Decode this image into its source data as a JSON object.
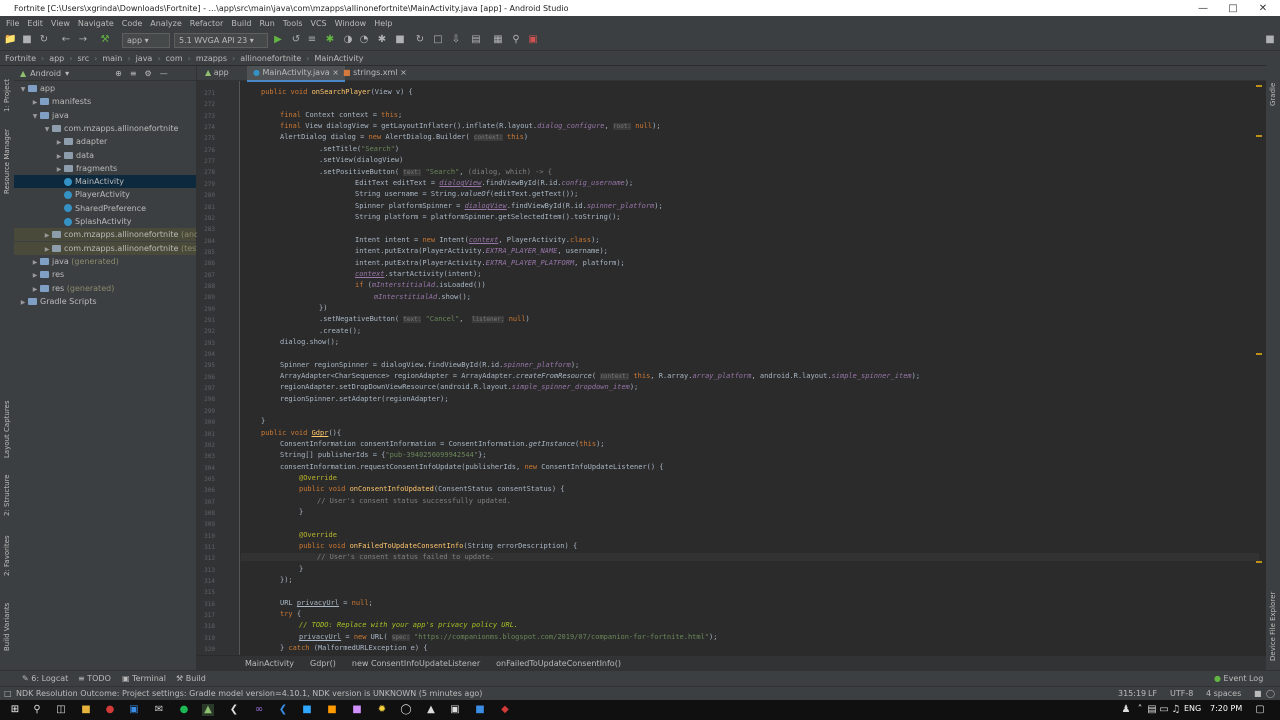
{
  "window": {
    "title": "Fortnite [C:\\Users\\xgrinda\\Downloads\\Fortnite] - ...\\app\\src\\main\\java\\com\\mzapps\\allinonefortnite\\MainActivity.java [app] - Android Studio"
  },
  "menu": [
    "File",
    "Edit",
    "View",
    "Navigate",
    "Code",
    "Analyze",
    "Refactor",
    "Build",
    "Run",
    "Tools",
    "VCS",
    "Window",
    "Help"
  ],
  "toolbar": {
    "module": "app",
    "device": "5.1  WVGA API 23"
  },
  "breadcrumbs": [
    "Fortnite",
    "app",
    "src",
    "main",
    "java",
    "com",
    "mzapps",
    "allinonefortnite",
    "MainActivity"
  ],
  "project": {
    "view": "Android",
    "items": [
      {
        "label": "app",
        "indent": 0,
        "type": "folder",
        "open": true
      },
      {
        "label": "manifests",
        "indent": 1,
        "type": "folder"
      },
      {
        "label": "java",
        "indent": 1,
        "type": "folder",
        "open": true
      },
      {
        "label": "com.mzapps.allinonefortnite",
        "indent": 2,
        "type": "pkg",
        "open": true
      },
      {
        "label": "adapter",
        "indent": 3,
        "type": "pkg"
      },
      {
        "label": "data",
        "indent": 3,
        "type": "pkg"
      },
      {
        "label": "fragments",
        "indent": 3,
        "type": "pkg"
      },
      {
        "label": "MainActivity",
        "indent": 3,
        "type": "class",
        "selected": true
      },
      {
        "label": "PlayerActivity",
        "indent": 3,
        "type": "class"
      },
      {
        "label": "SharedPreference",
        "indent": 3,
        "type": "class"
      },
      {
        "label": "SplashActivity",
        "indent": 3,
        "type": "class"
      },
      {
        "label": "com.mzapps.allinonefortnite",
        "suffix": "(androidTest)",
        "indent": 2,
        "type": "pkg",
        "hl": true
      },
      {
        "label": "com.mzapps.allinonefortnite",
        "suffix": "(test)",
        "indent": 2,
        "type": "pkg",
        "hl": true
      },
      {
        "label": "java",
        "suffix": "(generated)",
        "indent": 1,
        "type": "folder"
      },
      {
        "label": "res",
        "indent": 1,
        "type": "folder"
      },
      {
        "label": "res",
        "suffix": "(generated)",
        "indent": 1,
        "type": "folder"
      },
      {
        "label": "Gradle Scripts",
        "indent": 0,
        "type": "folder"
      }
    ]
  },
  "tabs": [
    "app",
    "MainActivity.java",
    "strings.xml"
  ],
  "line_numbers": [
    "271",
    "272",
    "273",
    "274",
    "275",
    "276",
    "277",
    "278",
    "279",
    "280",
    "281",
    "282",
    "283",
    "284",
    "285",
    "286",
    "287",
    "288",
    "289",
    "290",
    "291",
    "292",
    "293",
    "294",
    "295",
    "296",
    "297",
    "298",
    "299",
    "300",
    "301",
    "302",
    "303",
    "304",
    "305",
    "306",
    "307",
    "308",
    "309",
    "310",
    "311",
    "312",
    "313",
    "314",
    "315",
    "316",
    "317",
    "318",
    "319",
    "320",
    "321",
    "322",
    "323"
  ],
  "editor_breadcrumb": [
    "MainActivity",
    "Gdpr()",
    "new ConsentInfoUpdateListener",
    "onFailedToUpdateConsentInfo()"
  ],
  "bottom_tools": [
    "6: Logcat",
    "TODO",
    "Terminal",
    "Build",
    "Event Log"
  ],
  "status": {
    "message": "NDK Resolution Outcome: Project settings: Gradle model version=4.10.1, NDK version is UNKNOWN (5 minutes ago)",
    "position": "315:19",
    "line_sep": "LF",
    "encoding": "UTF-8",
    "indent": "4 spaces"
  },
  "left_tool_labels": [
    "1: Project",
    "Resource Manager",
    "Layout Captures",
    "2: Structure",
    "2: Favorites",
    "Build Variants"
  ],
  "right_tool_labels": [
    "Gradle",
    "Device File Explorer"
  ],
  "taskbar": {
    "lang": "ENG",
    "time": "7:20 PM"
  }
}
